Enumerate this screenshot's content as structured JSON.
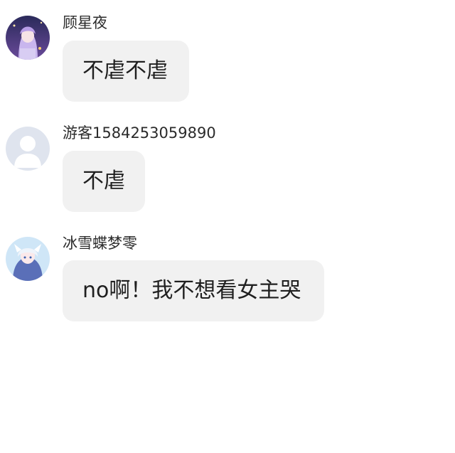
{
  "messages": [
    {
      "username": "顾星夜",
      "text": "不虐不虐",
      "avatar": "anime-girl-purple-avatar"
    },
    {
      "username": "游客1584253059890",
      "text": "不虐",
      "avatar": "default-user-avatar"
    },
    {
      "username": "冰雪蝶梦零",
      "text": "no啊！我不想看女主哭",
      "avatar": "anime-girl-blue-avatar"
    }
  ]
}
